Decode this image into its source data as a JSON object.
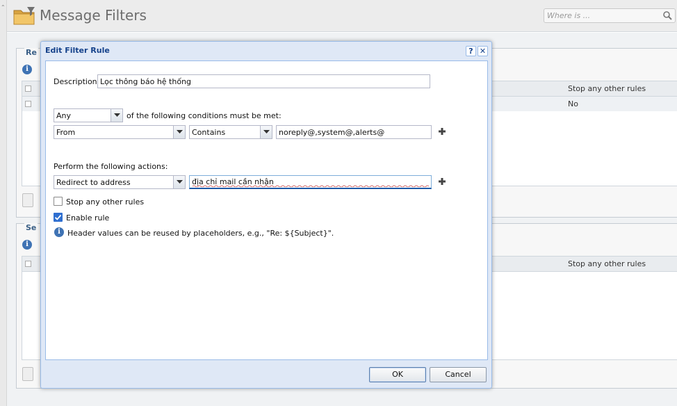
{
  "app": {
    "title": "Message Filters",
    "search_placeholder": "Where is ..."
  },
  "background": {
    "panel1": {
      "legend": "Re",
      "column_header": "Stop any other rules",
      "row_value": "No"
    },
    "panel2": {
      "legend": "Se",
      "column_header": "Stop any other rules"
    }
  },
  "dialog": {
    "title": "Edit Filter Rule",
    "help_label": "?",
    "close_label": "✕",
    "description_label": "Description:",
    "description_value": "Lọc thông báo hệ thống",
    "match_mode": "Any",
    "conditions_label": "of the following conditions must be met:",
    "condition": {
      "field": "From",
      "operator": "Contains",
      "value": "noreply@,system@,alerts@"
    },
    "actions_label": "Perform the following actions:",
    "action": {
      "type": "Redirect to address",
      "value": "địa chỉ mail cần nhận"
    },
    "stop_rules_label": "Stop any other rules",
    "stop_rules_checked": false,
    "enable_rule_label": "Enable rule",
    "enable_rule_checked": true,
    "hint": "Header values can be reused by placeholders, e.g., \"Re: ${Subject}\".",
    "ok_label": "OK",
    "cancel_label": "Cancel"
  },
  "icons": {
    "folder": "folder-filter-icon",
    "search": "search-icon",
    "add": "plus-icon",
    "info": "info-icon",
    "dropdown": "chevron-down-icon"
  },
  "colors": {
    "dialog_title": "#15428b",
    "dialog_border": "#99bbe8",
    "checkbox_checked": "#2f6fd0",
    "info_icon": "#3f73b4"
  }
}
